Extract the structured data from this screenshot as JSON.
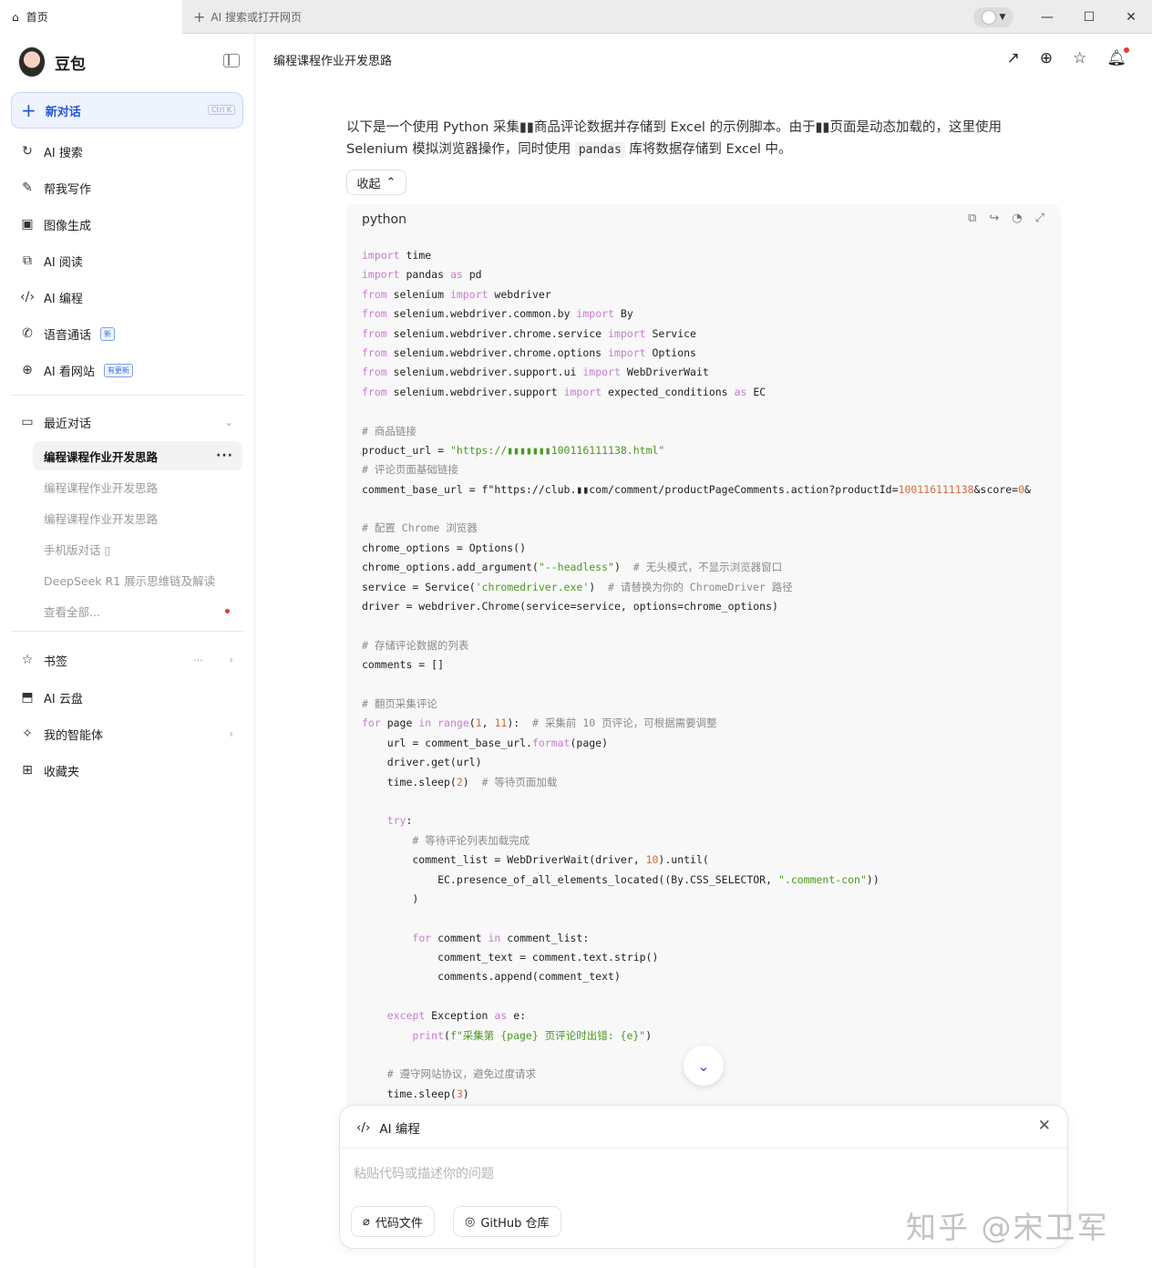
{
  "browser": {
    "home_tab": "首页",
    "new_tab": "AI 搜索或打开网页",
    "win_min": "—",
    "win_max": "☐",
    "win_close": "✕"
  },
  "sidebar": {
    "brand": "豆包",
    "new_chat": "新对话",
    "new_chat_shortcut": "Ctrl K",
    "nav": [
      {
        "icon": "ai-search-icon",
        "label": "AI 搜索"
      },
      {
        "icon": "writing-icon",
        "label": "帮我写作"
      },
      {
        "icon": "image-gen-icon",
        "label": "图像生成"
      },
      {
        "icon": "reading-icon",
        "label": "AI 阅读"
      },
      {
        "icon": "code-icon",
        "label": "AI 编程"
      },
      {
        "icon": "phone-icon",
        "label": "语音通话",
        "badge": "新"
      },
      {
        "icon": "globe-icon",
        "label": "AI 看网站",
        "badge": "有更新"
      }
    ],
    "recent_label": "最近对话",
    "recent": [
      "编程课程作业开发思路",
      "编程课程作业开发思路",
      "编程课程作业开发思路",
      "手机版对话 ▯",
      "DeepSeek R1 展示思维链及解读",
      "查看全部..."
    ],
    "bottom": [
      {
        "icon": "star-icon",
        "label": "书签",
        "extra": "···"
      },
      {
        "icon": "cloud-disk-icon",
        "label": "AI 云盘"
      },
      {
        "icon": "agent-icon",
        "label": "我的智能体"
      },
      {
        "icon": "favorites-icon",
        "label": "收藏夹"
      }
    ]
  },
  "header": {
    "title": "编程课程作业开发思路"
  },
  "message": {
    "intro_1": "以下是一个使用 Python 采集▮▮商品评论数据并存储到 Excel 的示例脚本。由于▮▮页面是动态加载的，这里使用 Selenium 模拟浏览器操作，同时使用 ",
    "intro_code": "pandas",
    "intro_2": " 库将数据存储到 Excel 中。",
    "collapse": "收起"
  },
  "code": {
    "language": "python",
    "lines": [
      "import time",
      "import pandas as pd",
      "from selenium import webdriver",
      "from selenium.webdriver.common.by import By",
      "from selenium.webdriver.chrome.service import Service",
      "from selenium.webdriver.chrome.options import Options",
      "from selenium.webdriver.support.ui import WebDriverWait",
      "from selenium.webdriver.support import expected_conditions as EC",
      "",
      "# 商品链接",
      "product_url = \"https://▮▮▮▮▮▮▮100116111138.html\"",
      "# 评论页面基础链接",
      "comment_base_url = f\"https://club.▮▮com/comment/productPageComments.action?productId=100116111138&score=0&",
      "",
      "# 配置 Chrome 浏览器",
      "chrome_options = Options()",
      "chrome_options.add_argument(\"--headless\")  # 无头模式，不显示浏览器窗口",
      "service = Service('chromedriver.exe')  # 请替换为你的 ChromeDriver 路径",
      "driver = webdriver.Chrome(service=service, options=chrome_options)",
      "",
      "# 存储评论数据的列表",
      "comments = []",
      "",
      "# 翻页采集评论",
      "for page in range(1, 11):  # 采集前 10 页评论，可根据需要调整",
      "    url = comment_base_url.format(page)",
      "    driver.get(url)",
      "    time.sleep(2)  # 等待页面加载",
      "",
      "    try:",
      "        # 等待评论列表加载完成",
      "        comment_list = WebDriverWait(driver, 10).until(",
      "            EC.presence_of_all_elements_located((By.CSS_SELECTOR, \".comment-con\"))",
      "        )",
      "",
      "        for comment in comment_list:",
      "            comment_text = comment.text.strip()",
      "            comments.append(comment_text)",
      "",
      "    except Exception as e:",
      "        print(f\"采集第 {page} 页评论时出错: {e}\")",
      "",
      "    # 遵守网站协议，避免过度请求",
      "    time.sleep(3)"
    ]
  },
  "composer": {
    "mode": "AI 编程",
    "placeholder": "粘贴代码或描述你的问题",
    "chip_files": "代码文件",
    "chip_github": "GitHub 仓库"
  },
  "watermark": "知乎 @宋卫军"
}
